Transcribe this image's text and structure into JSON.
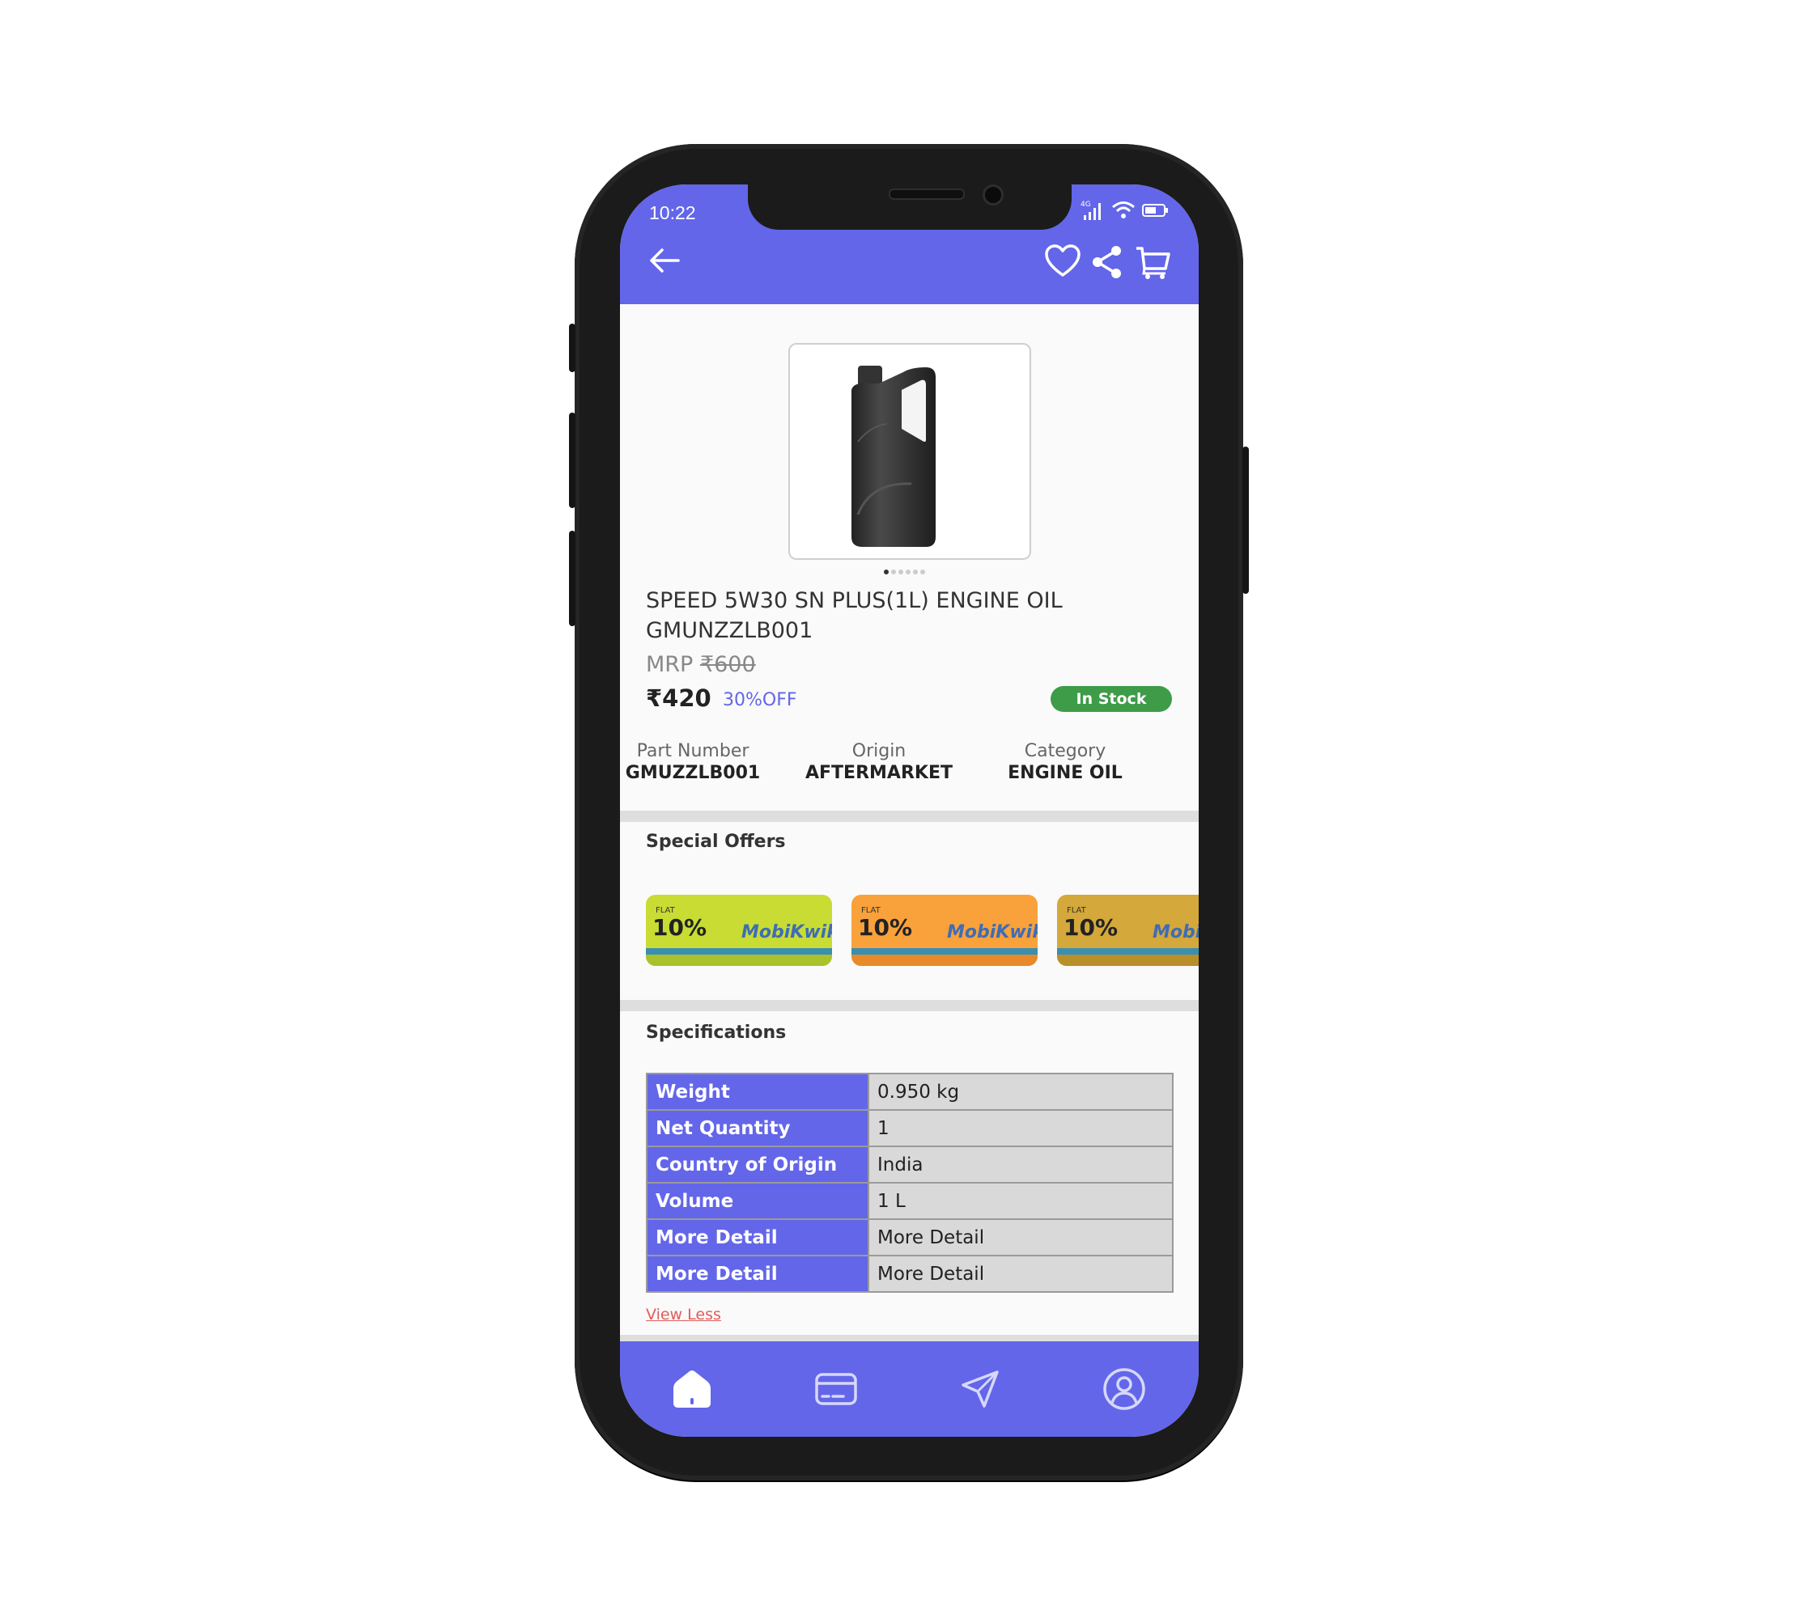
{
  "status_bar": {
    "time": "10:22",
    "network": "4G"
  },
  "header": {
    "icons": [
      "back-arrow-icon",
      "heart-icon",
      "share-icon",
      "cart-icon"
    ]
  },
  "product": {
    "title_line1": "SPEED 5W30 SN PLUS(1L) ENGINE OIL",
    "title_line2": "GMUNZZLB001",
    "mrp_label": "MRP",
    "mrp_value": "₹600",
    "price": "₹420",
    "discount": "30%OFF",
    "stock": "In Stock",
    "image_count": 6,
    "active_image": 0
  },
  "meta": [
    {
      "label": "Part Number",
      "value": "GMUZZLB001"
    },
    {
      "label": "Origin",
      "value": "AFTERMARKET"
    },
    {
      "label": "Category",
      "value": "ENGINE OIL"
    }
  ],
  "offers": {
    "title": "Special Offers",
    "cards": [
      {
        "flat": "FLAT",
        "percent": "10%",
        "brand": "MobiKwik",
        "bg": "#c8dc34"
      },
      {
        "flat": "FLAT",
        "percent": "10%",
        "brand": "MobiKwik",
        "bg": "#f9a13a"
      },
      {
        "flat": "FLAT",
        "percent": "10%",
        "brand": "MobiKwik",
        "bg": "#d4a83a"
      }
    ]
  },
  "specifications": {
    "title": "Specifications",
    "rows": [
      {
        "key": "Weight",
        "value": "0.950 kg"
      },
      {
        "key": "Net Quantity",
        "value": "1"
      },
      {
        "key": "Country of Origin",
        "value": "India"
      },
      {
        "key": "Volume",
        "value": "1 L"
      },
      {
        "key": "More Detail",
        "value": "More Detail"
      },
      {
        "key": "More Detail",
        "value": "More Detail"
      }
    ],
    "toggle_label": "View Less"
  },
  "bottom_nav": [
    "home-icon",
    "card-icon",
    "send-icon",
    "profile-icon"
  ],
  "colors": {
    "accent": "#6366e9",
    "stock_green": "#3e9c48",
    "link_red": "#e25c5c"
  }
}
